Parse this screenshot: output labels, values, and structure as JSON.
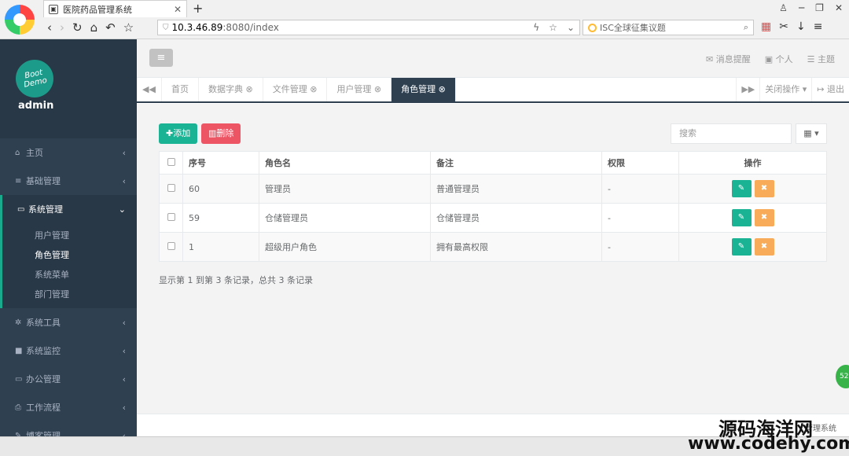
{
  "browser": {
    "tab_title": "医院药品管理系统",
    "url_host": "10.3.46.89",
    "url_rest": ":8080/index",
    "search_placeholder": "ISC全球征集议题"
  },
  "sidebar": {
    "avatar_text_1": "Boot",
    "avatar_text_2": "Demo",
    "username": "admin",
    "items": [
      {
        "label": "主页"
      },
      {
        "label": "基础管理"
      },
      {
        "label": "系统管理"
      },
      {
        "label": "系统工具"
      },
      {
        "label": "系统监控"
      },
      {
        "label": "办公管理"
      },
      {
        "label": "工作流程"
      },
      {
        "label": "博客管理"
      }
    ],
    "sub_items": [
      {
        "label": "用户管理"
      },
      {
        "label": "角色管理"
      },
      {
        "label": "系统菜单"
      },
      {
        "label": "部门管理"
      }
    ]
  },
  "header": {
    "notify": "消息提醒",
    "personal": "个人",
    "theme": "主题"
  },
  "tabs": [
    "首页",
    "数据字典",
    "文件管理",
    "用户管理",
    "角色管理"
  ],
  "tab_actions": {
    "close_ops": "关闭操作",
    "logout": "退出"
  },
  "toolbar": {
    "add": "添加",
    "delete": "删除",
    "search_placeholder": "搜索"
  },
  "table": {
    "headers": [
      "序号",
      "角色名",
      "备注",
      "权限",
      "操作"
    ],
    "rows": [
      {
        "id": "60",
        "name": "管理员",
        "remark": "普通管理员",
        "perm": "-"
      },
      {
        "id": "59",
        "name": "仓储管理员",
        "remark": "仓储管理员",
        "perm": "-"
      },
      {
        "id": "1",
        "name": "超级用户角色",
        "remark": "拥有最高权限",
        "perm": "-"
      }
    ]
  },
  "pager_text": "显示第 1 到第 3 条记录，总共 3 条记录",
  "footer_text": "管理系统",
  "watermark": {
    "line1": "源码海洋网",
    "line2": "www.codehy.com"
  },
  "bubble": "52"
}
